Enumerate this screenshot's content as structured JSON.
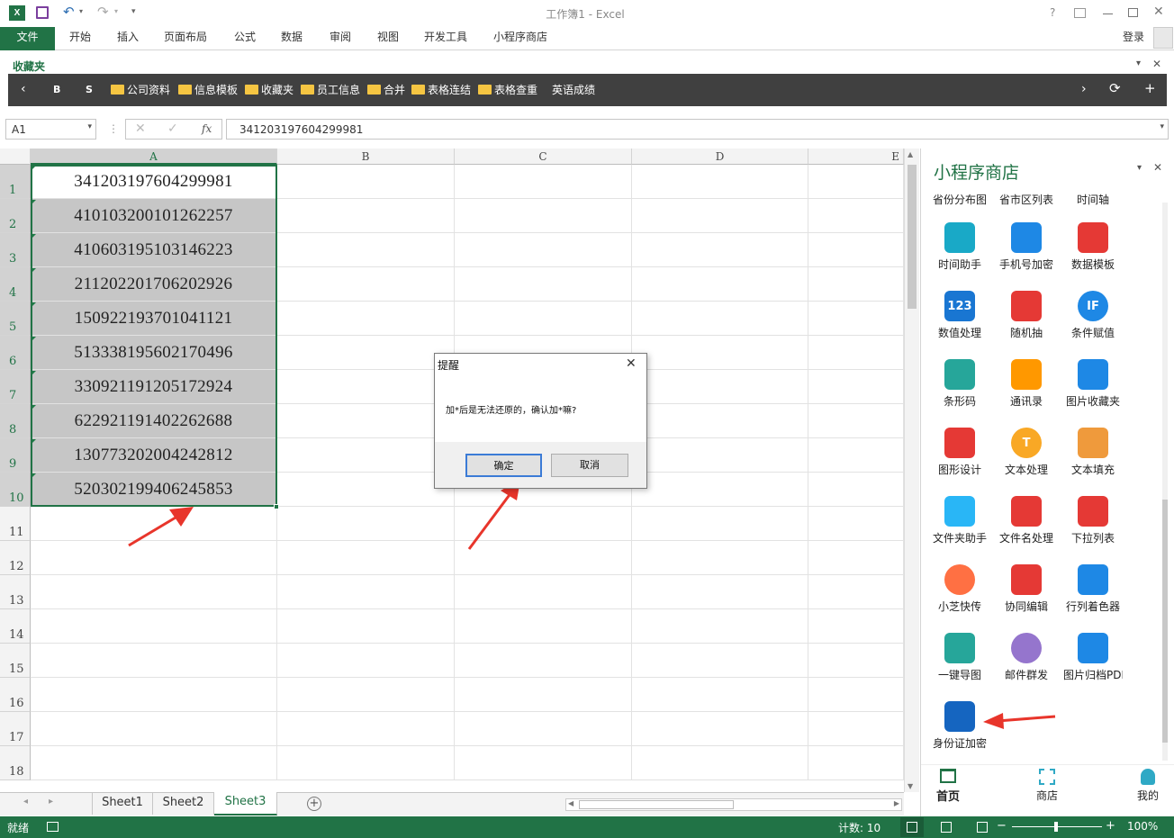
{
  "titlebar": {
    "title": "工作簿1 - Excel",
    "help": "?",
    "controls": [
      "restore",
      "minimize",
      "maximize",
      "close"
    ]
  },
  "ribbon": {
    "tabs": [
      "文件",
      "开始",
      "插入",
      "页面布局",
      "公式",
      "数据",
      "审阅",
      "视图",
      "开发工具",
      "小程序商店"
    ],
    "login": "登录"
  },
  "favorites": {
    "header": "收藏夹",
    "buttons": [
      "B",
      "S"
    ],
    "folders": [
      "公司资料",
      "信息模板",
      "收藏夹",
      "员工信息",
      "合并",
      "表格连结",
      "表格查重"
    ],
    "plain_item": "英语成绩"
  },
  "formula_bar": {
    "name_box": "A1",
    "fx": "fx",
    "value": "341203197604299981"
  },
  "grid": {
    "columns": [
      "A",
      "B",
      "C",
      "D",
      "E"
    ],
    "rows": [
      "1",
      "2",
      "3",
      "4",
      "5",
      "6",
      "7",
      "8",
      "9",
      "10",
      "11",
      "12",
      "13",
      "14",
      "15",
      "16",
      "17",
      "18"
    ],
    "column_a_values": [
      "341203197604299981",
      "410103200101262257",
      "410603195103146223",
      "211202201706202926",
      "150922193701041121",
      "513338195602170496",
      "330921191205172924",
      "622921191402262688",
      "130773202004242812",
      "520302199406245853"
    ]
  },
  "sheets": {
    "tabs": [
      "Sheet1",
      "Sheet2",
      "Sheet3"
    ],
    "active": "Sheet3"
  },
  "status": {
    "left": "就绪",
    "count": "计数: 10",
    "zoom": "100%"
  },
  "panel": {
    "title": "小程序商店",
    "top_row": [
      "省份分布图",
      "省市区列表",
      "时间轴"
    ],
    "items": [
      {
        "label": "时间助手",
        "icon": "clock-icon",
        "color": "#19a9c7"
      },
      {
        "label": "手机号加密",
        "icon": "phone-icon",
        "color": "#1e88e5"
      },
      {
        "label": "数据模板",
        "icon": "network-icon",
        "color": "#e53935"
      },
      {
        "label": "数值处理",
        "icon": "number-123-icon",
        "color": "#1976d2",
        "text": "123"
      },
      {
        "label": "随机抽",
        "icon": "wheel-icon",
        "color": "#e53935"
      },
      {
        "label": "条件赋值",
        "icon": "if-icon",
        "color": "#1e88e5",
        "text": "IF"
      },
      {
        "label": "条形码",
        "icon": "barcode-icon",
        "color": "#26a69a"
      },
      {
        "label": "通讯录",
        "icon": "contacts-icon",
        "color": "#ff9800"
      },
      {
        "label": "图片收藏夹",
        "icon": "image-icon",
        "color": "#1e88e5"
      },
      {
        "label": "图形设计",
        "icon": "shapes-icon",
        "color": "#e53935"
      },
      {
        "label": "文本处理",
        "icon": "text-t-icon",
        "color": "#f9a825",
        "text": "T"
      },
      {
        "label": "文本填充",
        "icon": "document-icon",
        "color": "#ef9a3c"
      },
      {
        "label": "文件夹助手",
        "icon": "folder-icon",
        "color": "#29b6f6"
      },
      {
        "label": "文件名处理",
        "icon": "files-icon",
        "color": "#e53935"
      },
      {
        "label": "下拉列表",
        "icon": "dropdown-icon",
        "color": "#e53935"
      },
      {
        "label": "小芝快传",
        "icon": "transfer-icon",
        "color": "#ff7043"
      },
      {
        "label": "协同编辑",
        "icon": "collab-icon",
        "color": "#e53935"
      },
      {
        "label": "行列着色器",
        "icon": "paint-bucket-icon",
        "color": "#1e88e5"
      },
      {
        "label": "一键导图",
        "icon": "export-image-icon",
        "color": "#26a69a"
      },
      {
        "label": "邮件群发",
        "icon": "mail-icon",
        "color": "#9575cd"
      },
      {
        "label": "图片归档PDF",
        "icon": "archive-icon",
        "color": "#1e88e5"
      },
      {
        "label": "身份证加密",
        "icon": "id-card-icon",
        "color": "#1565c0"
      }
    ],
    "nav": [
      "首页",
      "商店",
      "我的"
    ]
  },
  "dialog": {
    "title": "提醒",
    "message": "加*后是无法还原的，确认加*嘛?",
    "ok": "确定",
    "cancel": "取消"
  },
  "colors": {
    "excel_green": "#217346",
    "favbar_bg": "#404040",
    "panel_title": "#217346",
    "arrow_red": "#e8352b"
  }
}
